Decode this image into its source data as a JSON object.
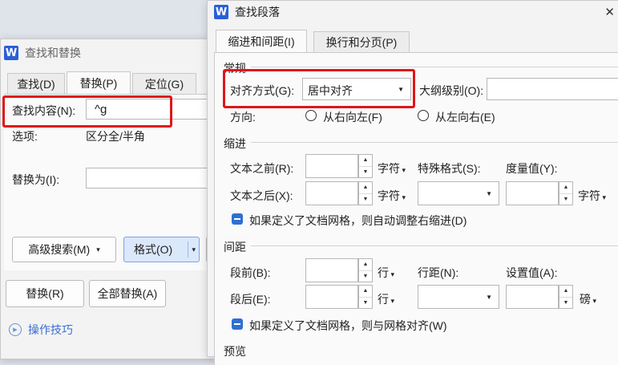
{
  "find_replace": {
    "title": "查找和替换",
    "tabs": [
      "查找(D)",
      "替换(P)",
      "定位(G)"
    ],
    "find_label": "查找内容(N):",
    "find_value": "^g",
    "options_label": "选项:",
    "options_value": "区分全/半角",
    "replace_label": "替换为(I):",
    "advanced_search": "高级搜索(M)",
    "format": "格式(O)",
    "replace_btn": "替换(R)",
    "replace_all_btn": "全部替换(A)",
    "tips": "操作技巧"
  },
  "paragraph": {
    "title": "查找段落",
    "close": "✕",
    "tabs": [
      "缩进和间距(I)",
      "换行和分页(P)"
    ],
    "general": {
      "heading": "常规",
      "align_label": "对齐方式(G):",
      "align_value": "居中对齐",
      "outline_label": "大纲级别(O):",
      "direction_label": "方向:",
      "rtl": "从右向左(F)",
      "ltr": "从左向右(E)"
    },
    "indent": {
      "heading": "缩进",
      "before_label": "文本之前(R):",
      "after_label": "文本之后(X):",
      "unit_char": "字符",
      "special_label": "特殊格式(S):",
      "measure_label": "度量值(Y):",
      "grid_check": "如果定义了文档网格，则自动调整右缩进(D)"
    },
    "spacing": {
      "heading": "间距",
      "before_label": "段前(B):",
      "after_label": "段后(E):",
      "unit_line": "行",
      "linespacing_label": "行距(N):",
      "setting_label": "设置值(A):",
      "unit_pound": "磅",
      "grid_check": "如果定义了文档网格，则与网格对齐(W)"
    },
    "preview_heading": "预览"
  }
}
